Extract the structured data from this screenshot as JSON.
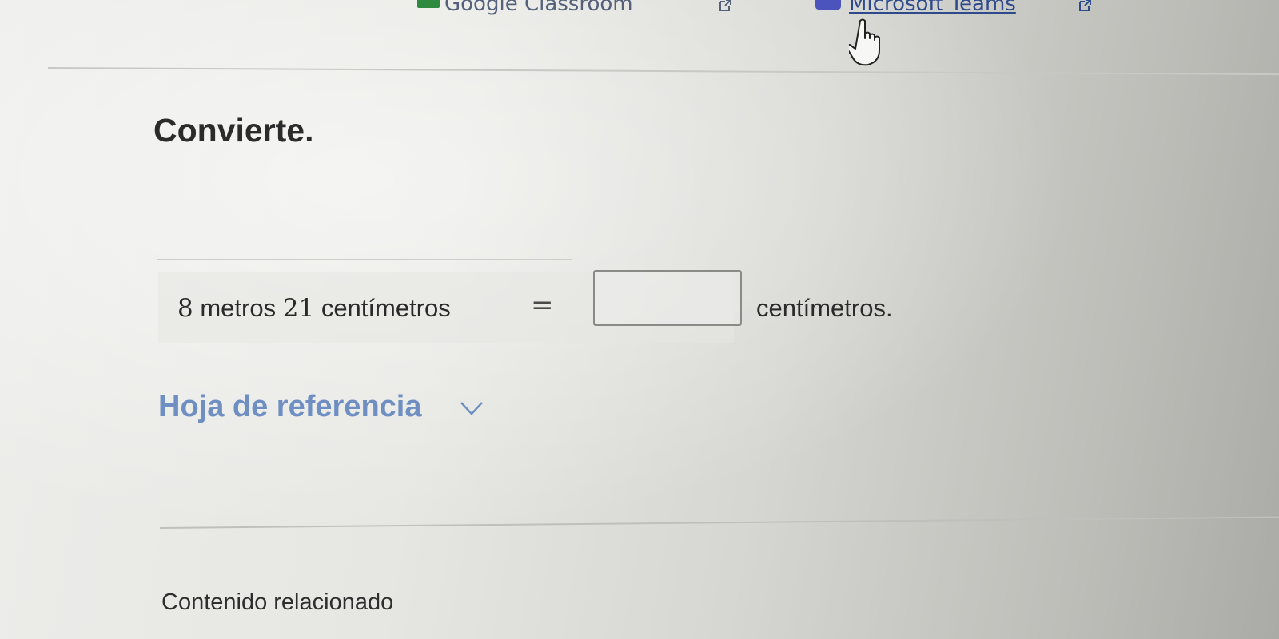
{
  "topbar": {
    "classroom_label": "Google Classroom",
    "teams_label": "Microsoft Teams"
  },
  "exercise": {
    "title": "Convierte.",
    "expression": {
      "meters_value": "8",
      "meters_unit": "metros",
      "cm_value": "21",
      "cm_unit": "centímetros",
      "equals": "=",
      "answer_value": "",
      "answer_unit": "centímetros."
    }
  },
  "reference_label": "Hoja de referencia",
  "related_label": "Contenido relacionado",
  "colors": {
    "link_blue": "#6f8fc2",
    "teams_purple": "#4b53bc",
    "classroom_green": "#2e8a3e"
  },
  "icons": [
    "external-link-icon",
    "hand-cursor-icon",
    "chevron-down-icon"
  ]
}
